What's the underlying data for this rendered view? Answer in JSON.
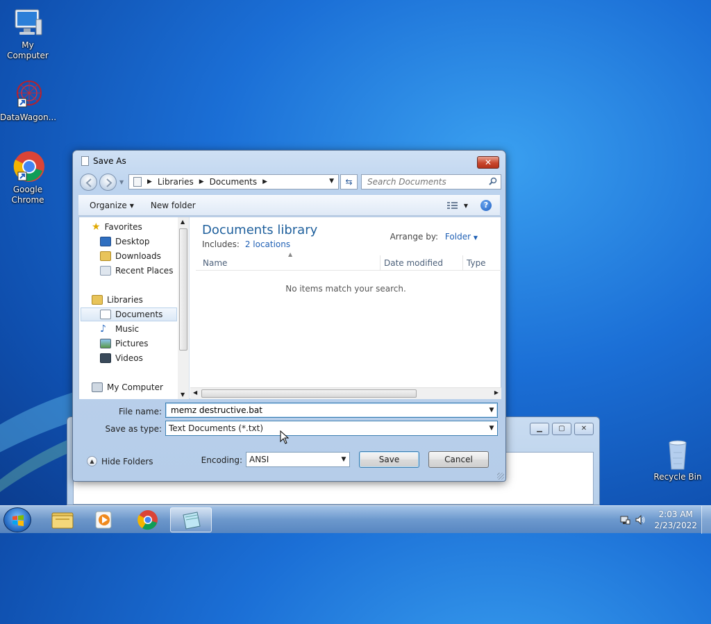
{
  "desktop": {
    "icons": [
      {
        "label": "My Computer"
      },
      {
        "label": "DataWagon..."
      },
      {
        "label": "Google Chrome"
      },
      {
        "label": "Recycle Bin"
      }
    ]
  },
  "dialog": {
    "title": "Save As",
    "close_label": "✕",
    "breadcrumb": [
      "Libraries",
      "Documents"
    ],
    "search_placeholder": "Search Documents",
    "toolbar": {
      "organize": "Organize",
      "new_folder": "New folder"
    },
    "nav": {
      "favorites": "Favorites",
      "favorites_items": [
        "Desktop",
        "Downloads",
        "Recent Places"
      ],
      "libraries": "Libraries",
      "libraries_items": [
        "Documents",
        "Music",
        "Pictures",
        "Videos"
      ],
      "my_computer": "My Computer"
    },
    "library": {
      "title": "Documents library",
      "includes_label": "Includes:",
      "includes_link": "2 locations",
      "arrange_label": "Arrange by:",
      "arrange_value": "Folder"
    },
    "columns": [
      "Name",
      "Date modified",
      "Type"
    ],
    "empty_message": "No items match your search.",
    "file_name_label": "File name:",
    "file_name_value": "memz destructive.bat",
    "save_type_label": "Save as type:",
    "save_type_value": "Text Documents (*.txt)",
    "encoding_label": "Encoding:",
    "encoding_value": "ANSI",
    "save_button": "Save",
    "cancel_button": "Cancel",
    "hide_folders": "Hide Folders"
  },
  "taskbar": {
    "time": "2:03 AM",
    "date": "2/23/2022"
  },
  "colors": {
    "accent": "#1e5f9c",
    "link": "#1e5fb4",
    "close_button": "#c8472d"
  }
}
